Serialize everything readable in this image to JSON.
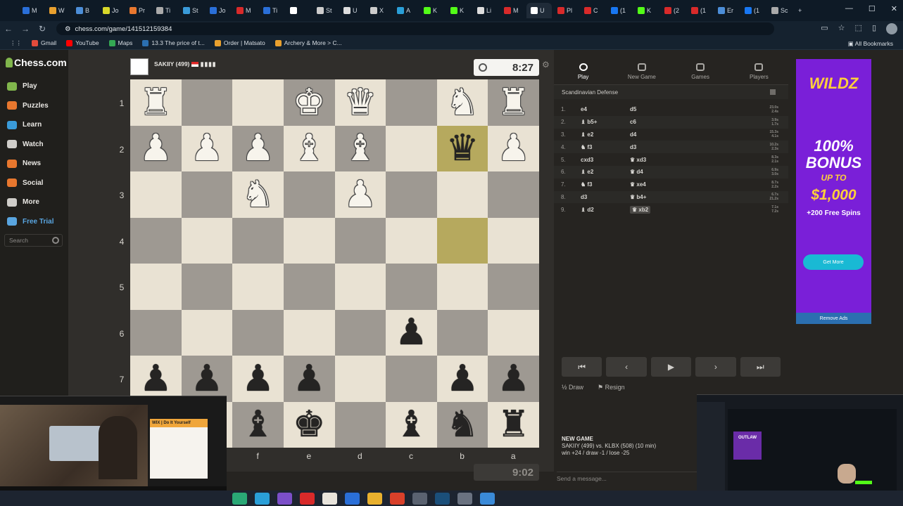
{
  "browser": {
    "url": "chess.com/game/141512159384",
    "tabs": [
      "M",
      "W",
      "B",
      "Jo",
      "Pr",
      "Ti",
      "St",
      "Jo",
      "M",
      "Ti",
      "",
      "St",
      "U",
      "X",
      "A",
      "K",
      "K",
      "Li",
      "M",
      "U",
      "Pl",
      "C",
      "(1",
      "K",
      "(2",
      "(1",
      "Er",
      "(1",
      "Sc"
    ],
    "bookmarks": [
      "Gmail",
      "YouTube",
      "Maps",
      "13.3 The price of t...",
      "Order | Matsato",
      "Archery & More > C..."
    ],
    "all_bookmarks": "All Bookmarks"
  },
  "sidebar": {
    "logo": "Chess.com",
    "items": [
      {
        "label": "Play",
        "color": "#81b64c"
      },
      {
        "label": "Puzzles",
        "color": "#e8772e"
      },
      {
        "label": "Learn",
        "color": "#3a9bd9"
      },
      {
        "label": "Watch",
        "color": "#cfcdc9"
      },
      {
        "label": "News",
        "color": "#e8772e"
      },
      {
        "label": "Social",
        "color": "#e8772e"
      },
      {
        "label": "More",
        "color": "#cfcdc9"
      },
      {
        "label": "Free Trial",
        "color": "#59a5e0"
      }
    ],
    "search_placeholder": "Search"
  },
  "game": {
    "top_player": "SAKIIY (499)",
    "top_clock": "8:27",
    "bottom_clock": "9:02",
    "ranks": [
      "1",
      "2",
      "3",
      "4",
      "5",
      "6",
      "7"
    ],
    "files": [
      "f",
      "e",
      "d",
      "c",
      "b",
      "a"
    ],
    "board": [
      [
        "wR",
        "",
        "",
        "wK",
        "wQ",
        "",
        "wN",
        "wR"
      ],
      [
        "wP",
        "wP",
        "wP",
        "wB",
        "wB",
        "",
        "bQ",
        "wP"
      ],
      [
        "",
        "",
        "wN",
        "",
        "wP",
        "",
        "",
        ""
      ],
      [
        "",
        "",
        "",
        "",
        "",
        "",
        "",
        ""
      ],
      [
        "",
        "",
        "",
        "",
        "",
        "",
        "",
        ""
      ],
      [
        "",
        "",
        "",
        "",
        "",
        "bP",
        "",
        ""
      ],
      [
        "bP",
        "bP",
        "bP",
        "bP",
        "",
        "",
        "bP",
        "bP"
      ],
      [
        "",
        "",
        "bB",
        "bK",
        "",
        "bB",
        "bN",
        "bR"
      ]
    ],
    "highlighted": [
      [
        1,
        6
      ],
      [
        3,
        6
      ]
    ]
  },
  "panel": {
    "tabs": [
      {
        "label": "Play",
        "active": true
      },
      {
        "label": "New Game",
        "active": false
      },
      {
        "label": "Games",
        "active": false
      },
      {
        "label": "Players",
        "active": false
      }
    ],
    "opening": "Scandinavian Defense",
    "moves": [
      {
        "n": "1.",
        "w": "e4",
        "b": "d5",
        "t1": "23.0s",
        "t2": "2.4s"
      },
      {
        "n": "2.",
        "w": "♝ b5+",
        "b": "c6",
        "t1": "3.9s",
        "t2": "1.7s"
      },
      {
        "n": "3.",
        "w": "♝ e2",
        "b": "d4",
        "t1": "15.3s",
        "t2": "4.1s"
      },
      {
        "n": "4.",
        "w": "♞ f3",
        "b": "d3",
        "t1": "10.2s",
        "t2": "2.3s"
      },
      {
        "n": "5.",
        "w": "cxd3",
        "b": "♛ xd3",
        "t1": "8.3s",
        "t2": "2.1s"
      },
      {
        "n": "6.",
        "w": "♝ e2",
        "b": "♛ d4",
        "t1": "6.9s",
        "t2": "3.0s"
      },
      {
        "n": "7.",
        "w": "♞ f3",
        "b": "♛ xe4",
        "t1": "8.7s",
        "t2": "2.2s"
      },
      {
        "n": "8.",
        "w": "d3",
        "b": "♛ b4+",
        "t1": "6.7s",
        "t2": "21.2s"
      },
      {
        "n": "9.",
        "w": "♝ d2",
        "b": "♛ xb2",
        "t1": "7.1s",
        "t2": "7.2s"
      }
    ],
    "draw": "Draw",
    "resign": "Resign",
    "new_game_title": "NEW GAME",
    "new_game_players": "SAKIIY (499) vs. KLBX (508) (10 min)",
    "new_game_points": "win +24 / draw -1 / lose -25",
    "message_placeholder": "Send a message..."
  },
  "ad": {
    "brand": "WILDZ",
    "bonus": "100% BONUS",
    "upto": "UP TO",
    "amount": "$1,000",
    "spins": "+200 Free Spins",
    "cta": "Get More",
    "remove": "Remove Ads"
  },
  "overlay": {
    "wix_title": "WIX | Do It Yourself",
    "outlaw": "OUTLAW"
  }
}
